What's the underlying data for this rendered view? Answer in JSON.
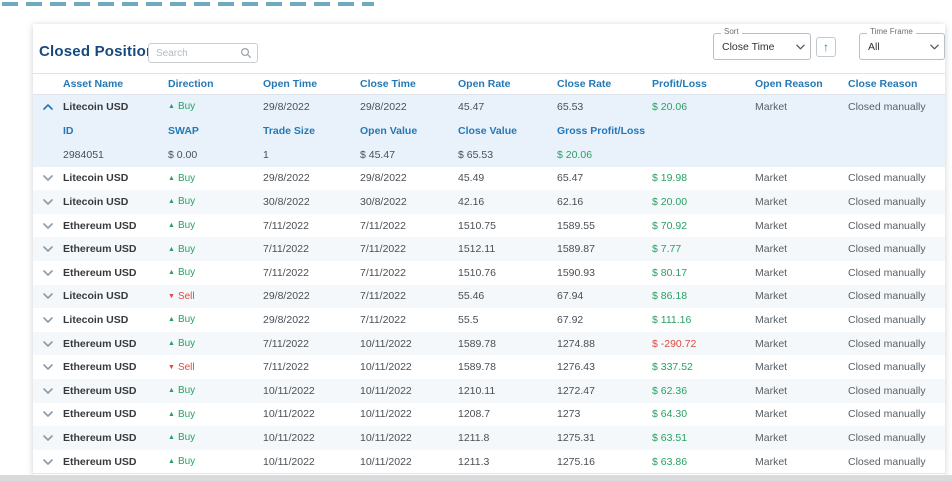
{
  "page": {
    "title": "Closed Positions",
    "search_placeholder": "Search",
    "sort": {
      "label": "Sort",
      "value": "Close Time"
    },
    "time_frame": {
      "label": "Time Frame",
      "value": "All"
    }
  },
  "icons": {
    "search": "magnifier",
    "sort_direction": "up-arrow",
    "buy": "up-triangle",
    "sell": "down-triangle",
    "expand": "chevron-down",
    "collapse": "chevron-up"
  },
  "colors": {
    "accent_blue": "#2478b5",
    "title_navy": "#15497f",
    "positive_green": "#27a163",
    "negative_red": "#e2483d",
    "row_alt": "#f5f8fa",
    "expanded_row_bg": "#e9f2fb"
  },
  "table": {
    "columns": [
      "Asset Name",
      "Direction",
      "Open Time",
      "Close Time",
      "Open Rate",
      "Close Rate",
      "Profit/Loss",
      "Open Reason",
      "Close Reason"
    ],
    "detail_columns": [
      "ID",
      "SWAP",
      "Trade Size",
      "Open Value",
      "Close Value",
      "Gross Profit/Loss"
    ],
    "rows": [
      {
        "asset": "Litecoin USD",
        "direction": "Buy",
        "open_time": "29/8/2022",
        "close_time": "29/8/2022",
        "open_rate": "45.47",
        "close_rate": "65.53",
        "profit": "$ 20.06",
        "open_reason": "Market",
        "close_reason": "Closed manually",
        "expanded": true,
        "details": {
          "id": "2984051",
          "swap": "$ 0.00",
          "trade_size": "1",
          "open_value": "$ 45.47",
          "close_value": "$ 65.53",
          "gross_profit": "$ 20.06"
        }
      },
      {
        "asset": "Litecoin USD",
        "direction": "Buy",
        "open_time": "29/8/2022",
        "close_time": "29/8/2022",
        "open_rate": "45.49",
        "close_rate": "65.47",
        "profit": "$ 19.98",
        "open_reason": "Market",
        "close_reason": "Closed manually"
      },
      {
        "asset": "Litecoin USD",
        "direction": "Buy",
        "open_time": "30/8/2022",
        "close_time": "30/8/2022",
        "open_rate": "42.16",
        "close_rate": "62.16",
        "profit": "$ 20.00",
        "open_reason": "Market",
        "close_reason": "Closed manually"
      },
      {
        "asset": "Ethereum USD",
        "direction": "Buy",
        "open_time": "7/11/2022",
        "close_time": "7/11/2022",
        "open_rate": "1510.75",
        "close_rate": "1589.55",
        "profit": "$ 70.92",
        "open_reason": "Market",
        "close_reason": "Closed manually"
      },
      {
        "asset": "Ethereum USD",
        "direction": "Buy",
        "open_time": "7/11/2022",
        "close_time": "7/11/2022",
        "open_rate": "1512.11",
        "close_rate": "1589.87",
        "profit": "$ 7.77",
        "open_reason": "Market",
        "close_reason": "Closed manually"
      },
      {
        "asset": "Ethereum USD",
        "direction": "Buy",
        "open_time": "7/11/2022",
        "close_time": "7/11/2022",
        "open_rate": "1510.76",
        "close_rate": "1590.93",
        "profit": "$ 80.17",
        "open_reason": "Market",
        "close_reason": "Closed manually"
      },
      {
        "asset": "Litecoin USD",
        "direction": "Sell",
        "open_time": "29/8/2022",
        "close_time": "7/11/2022",
        "open_rate": "55.46",
        "close_rate": "67.94",
        "profit": "$ 86.18",
        "open_reason": "Market",
        "close_reason": "Closed manually"
      },
      {
        "asset": "Litecoin USD",
        "direction": "Buy",
        "open_time": "29/8/2022",
        "close_time": "7/11/2022",
        "open_rate": "55.5",
        "close_rate": "67.92",
        "profit": "$ 111.16",
        "open_reason": "Market",
        "close_reason": "Closed manually"
      },
      {
        "asset": "Ethereum USD",
        "direction": "Buy",
        "open_time": "7/11/2022",
        "close_time": "10/11/2022",
        "open_rate": "1589.78",
        "close_rate": "1274.88",
        "profit": "$ -290.72",
        "open_reason": "Market",
        "close_reason": "Closed manually"
      },
      {
        "asset": "Ethereum USD",
        "direction": "Sell",
        "open_time": "7/11/2022",
        "close_time": "10/11/2022",
        "open_rate": "1589.78",
        "close_rate": "1276.43",
        "profit": "$ 337.52",
        "open_reason": "Market",
        "close_reason": "Closed manually"
      },
      {
        "asset": "Ethereum USD",
        "direction": "Buy",
        "open_time": "10/11/2022",
        "close_time": "10/11/2022",
        "open_rate": "1210.11",
        "close_rate": "1272.47",
        "profit": "$ 62.36",
        "open_reason": "Market",
        "close_reason": "Closed manually"
      },
      {
        "asset": "Ethereum USD",
        "direction": "Buy",
        "open_time": "10/11/2022",
        "close_time": "10/11/2022",
        "open_rate": "1208.7",
        "close_rate": "1273",
        "profit": "$ 64.30",
        "open_reason": "Market",
        "close_reason": "Closed manually"
      },
      {
        "asset": "Ethereum USD",
        "direction": "Buy",
        "open_time": "10/11/2022",
        "close_time": "10/11/2022",
        "open_rate": "1211.8",
        "close_rate": "1275.31",
        "profit": "$ 63.51",
        "open_reason": "Market",
        "close_reason": "Closed manually"
      },
      {
        "asset": "Ethereum USD",
        "direction": "Buy",
        "open_time": "10/11/2022",
        "close_time": "10/11/2022",
        "open_rate": "1211.3",
        "close_rate": "1275.16",
        "profit": "$ 63.86",
        "open_reason": "Market",
        "close_reason": "Closed manually"
      }
    ]
  }
}
